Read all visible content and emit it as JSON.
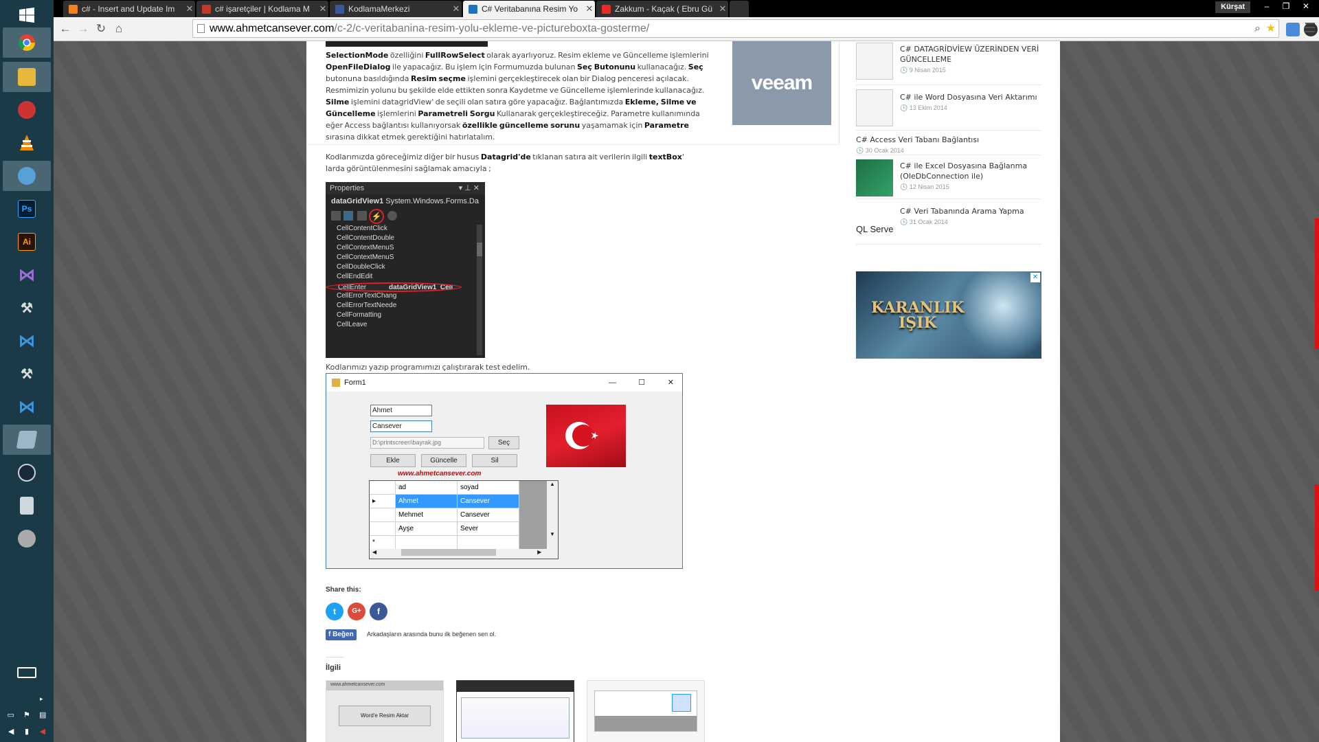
{
  "taskbar": {
    "icons": [
      "windows-logo",
      "chrome",
      "file-explorer",
      "snipping-tool",
      "vlc",
      "paint",
      "photoshop",
      "illustrator",
      "visual-studio",
      "tools",
      "vscode",
      "tools",
      "vscode",
      "notes",
      "steam",
      "calculator",
      "media"
    ],
    "bottom": {
      "keyboard": "keyboard-icon"
    }
  },
  "browser": {
    "tabs": [
      {
        "title": "c# - Insert and Update Im",
        "color": "#f48024"
      },
      {
        "title": "c# işaretçiler | Kodlama M",
        "color": "#c0392b"
      },
      {
        "title": "KodlamaMerkezi",
        "color": "#3b5998"
      },
      {
        "title": "C# Veritabanına Resim Yo",
        "color": "#1e73be",
        "active": true
      },
      {
        "title": "Zakkum - Kaçak ( Ebru Gü",
        "color": "#e52d27"
      }
    ],
    "close_glyph": "✕",
    "user": "Kürşat",
    "window_buttons": {
      "min": "–",
      "restore": "❐",
      "close": "✕"
    },
    "url": {
      "host": "www.ahmetcansever.com",
      "path": "/c-2/c-veritabanina-resim-yolu-ekleme-ve-pictureboxta-gosterme/"
    }
  },
  "article": {
    "para1": [
      {
        "b": "SelectionMode"
      },
      {
        "t": " özelliğini "
      },
      {
        "b": "FullRowSelect"
      },
      {
        "t": " olarak ayarlıyoruz. Resim ekleme ve Güncelleme işlemlerini "
      },
      {
        "b": "OpenFileDialog"
      },
      {
        "t": " ile yapacağız. Bu işlem için Formumuzda bulunan "
      },
      {
        "b": "Seç Butonunu"
      },
      {
        "t": " kullanacağız. "
      },
      {
        "b": "Seç"
      },
      {
        "t": " butonuna basıldığında "
      },
      {
        "b": "Resim seçme"
      },
      {
        "t": " işlemini gerçekleştirecek olan bir Dialog penceresi açılacak. Resmimizin yolunu bu şekilde elde ettikten sonra Kaydetme ve Güncelleme işlemlerinde kullanacağız. "
      },
      {
        "b": "Silme"
      },
      {
        "t": " işlemini datagridView' de seçili olan satıra göre yapacağız. Bağlantımızda "
      },
      {
        "b": "Ekleme, Silme ve Güncelleme"
      },
      {
        "t": " işlemlerini "
      },
      {
        "b": "Parametreli Sorgu"
      },
      {
        "t": " Kullanarak gerçekleştireceğiz. Parametre kullanımında eğer Access bağlantısı kullanıyorsak "
      },
      {
        "b": "özellikle güncelleme sorunu"
      },
      {
        "t": " yaşamamak için "
      },
      {
        "b": "Parametre"
      },
      {
        "t": " sırasına dikkat etmek gerektiğini hatırlatalım."
      }
    ],
    "para2": [
      {
        "t": "Kodlarımızda göreceğimiz diğer bir husus "
      },
      {
        "b": "Datagrid'de"
      },
      {
        "t": " tıklanan satıra ait verilerin ilgili "
      },
      {
        "b": "textBox"
      },
      {
        "t": "' larda görüntülenmesini sağlamak amacıyla ;"
      }
    ],
    "properties": {
      "title": "Properties",
      "object": "dataGridView1",
      "type": "System.Windows.Forms.Da",
      "events": [
        "CellContentClick",
        "CellContentDouble",
        "CellContextMenuS",
        "CellContextMenuS",
        "CellDoubleClick",
        "CellEndEdit",
        "CellEnter",
        "CellErrorTextChang",
        "CellErrorTextNeede",
        "CellFormatting",
        "CellLeave"
      ],
      "cellenter_value": "dataGridView1_Cell"
    },
    "para3": "Kodlarımızı yazıp programımızı çalıştırarak test edelim.",
    "form": {
      "title": "Form1",
      "name_value": "Ahmet",
      "surname_value": "Cansever",
      "path_value": "D:\\printscreen\\bayrak.jpg",
      "select_btn": "Seç",
      "add_btn": "Ekle",
      "update_btn": "Güncelle",
      "delete_btn": "Sil",
      "watermark": "www.ahmetcansever.com",
      "grid_headers": [
        "ad",
        "soyad"
      ],
      "grid_rows": [
        [
          "Ahmet",
          "Cansever"
        ],
        [
          "Mehmet",
          "Cansever"
        ],
        [
          "Ayşe",
          "Sever"
        ]
      ],
      "new_row_marker": "*"
    },
    "share": {
      "heading": "Share this:"
    },
    "like": {
      "button": "Beğen",
      "text": "Arkadaşların arasında bunu ilk beğenen sen ol."
    },
    "related_heading": "İlgili",
    "related_thumb1": {
      "url": "www.ahmetcansever.com",
      "button": "Word'e Resim Aktar"
    }
  },
  "sidebar": {
    "ad1": "veeam",
    "posts": [
      {
        "title": "C# DATAGRİDVİEW ÜZERİNDEN VERİ GÜNCELLEME",
        "date": "9 Nisan 2015"
      },
      {
        "title": "C# ile Word Dosyasına Veri Aktarımı",
        "date": "13 Ekim 2014"
      },
      {
        "title": "C# Access Veri Tabanı Bağlantısı",
        "date": "30 Ocak 2014"
      },
      {
        "title": "C# ile Excel Dosyasına Bağlanma (OleDbConnection ile)",
        "date": "12 Nisan 2015"
      },
      {
        "title": "C# Veri Tabanında Arama Yapma",
        "date": "31 Ocak 2014"
      }
    ],
    "thumb_text": "QL Serve",
    "ad2": {
      "line1": "KARANLIK",
      "line2": "IŞIK"
    }
  }
}
